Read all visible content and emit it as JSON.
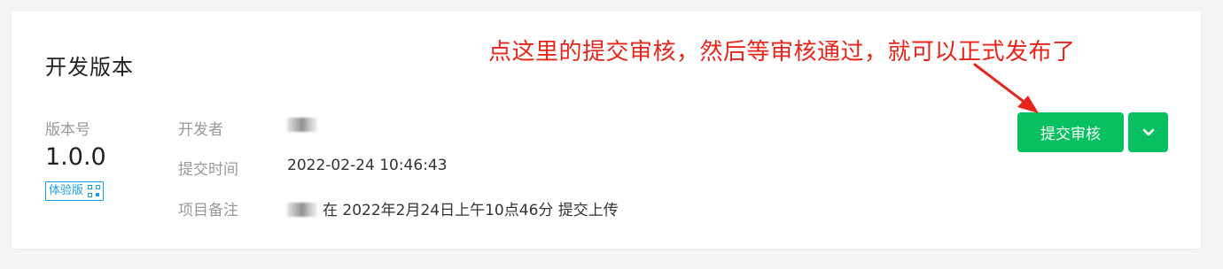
{
  "card": {
    "title": "开发版本"
  },
  "annotation": {
    "text": "点这里的提交审核，然后等审核通过，就可以正式发布了",
    "color": "#e8251a"
  },
  "version": {
    "label": "版本号",
    "number": "1.0.0",
    "tag": "体验版",
    "tag_icon": "qr-code-icon"
  },
  "details": {
    "developer_label": "开发者",
    "developer_value": "",
    "submit_time_label": "提交时间",
    "submit_time_value": "2022-02-24 10:46:43",
    "note_label": "项目备注",
    "note_value": "在 2022年2月24日上午10点46分 提交上传"
  },
  "actions": {
    "submit_label": "提交审核",
    "dropdown_icon": "chevron-down-icon",
    "accent": "#07c160"
  }
}
